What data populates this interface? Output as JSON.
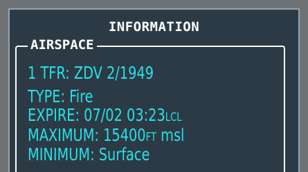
{
  "window": {
    "title": "INFORMATION"
  },
  "airspace": {
    "group_label": "AIRSPACE",
    "tfr_line": "1 TFR: ZDV 2/1949",
    "type_line": "TYPE: Fire",
    "expire": {
      "label": "EXPIRE: ",
      "value": "07/02 03:23",
      "unit": "LCL"
    },
    "maximum": {
      "label": "MAXIMUM: ",
      "value": "15400",
      "unit": "FT",
      "reference": " msl"
    },
    "minimum_line": "MINIMUM: Surface"
  },
  "colors": {
    "panel_bg": "#2c3a45",
    "text_cyan": "#27e0e6",
    "text_white": "#ffffff",
    "bezel": "#6f7275"
  }
}
